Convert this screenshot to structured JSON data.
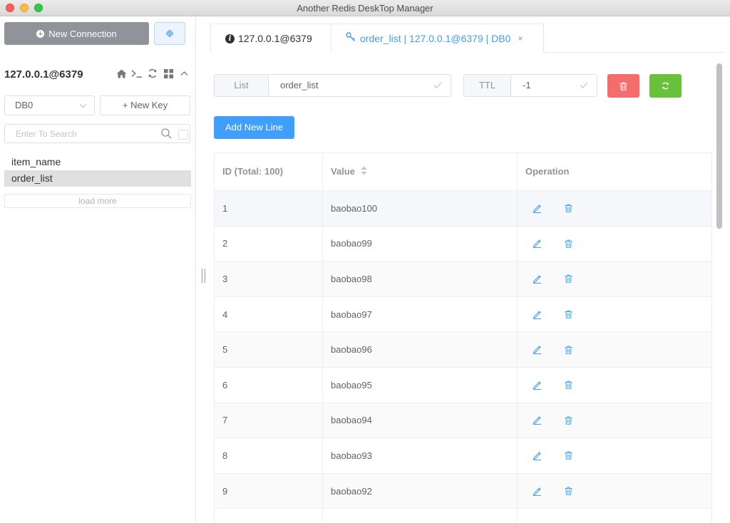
{
  "window": {
    "title": "Another Redis DeskTop Manager"
  },
  "sidebar": {
    "new_connection_label": "New Connection",
    "connection_name": "127.0.0.1@6379",
    "db_select_value": "DB0",
    "new_key_label": "+ New Key",
    "search_placeholder": "Enter To Search",
    "keys": [
      "item_name",
      "order_list"
    ],
    "active_key": "order_list",
    "load_more_label": "load more"
  },
  "tabs": [
    {
      "label": "127.0.0.1@6379",
      "icon": "info-circle-icon",
      "active": false
    },
    {
      "label": "order_list | 127.0.0.1@6379 | DB0",
      "icon": "key-icon",
      "active": true,
      "close": "×"
    }
  ],
  "key_detail": {
    "type_label": "List",
    "key_value": "order_list",
    "ttl_label": "TTL",
    "ttl_value": "-1",
    "add_line_label": "Add New Line"
  },
  "table": {
    "headers": [
      "ID (Total: 100)",
      "Value",
      "Operation"
    ],
    "rows": [
      {
        "id": "1",
        "value": "baobao100"
      },
      {
        "id": "2",
        "value": "baobao99"
      },
      {
        "id": "3",
        "value": "baobao98"
      },
      {
        "id": "4",
        "value": "baobao97"
      },
      {
        "id": "5",
        "value": "baobao96"
      },
      {
        "id": "6",
        "value": "baobao95"
      },
      {
        "id": "7",
        "value": "baobao94"
      },
      {
        "id": "8",
        "value": "baobao93"
      },
      {
        "id": "9",
        "value": "baobao92"
      },
      {
        "id": "",
        "value": ""
      }
    ]
  },
  "colors": {
    "accent": "#409eff",
    "danger": "#f56c6c",
    "success": "#67c23a",
    "gray_button": "#909399"
  }
}
